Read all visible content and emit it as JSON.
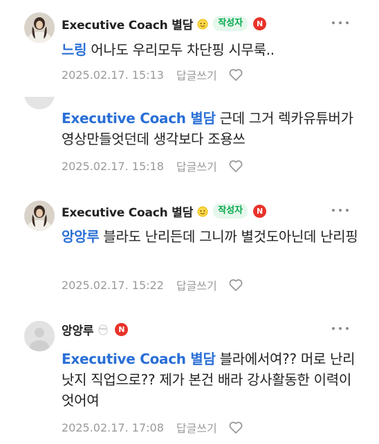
{
  "comments": [
    {
      "author": "Executive Coach 별담",
      "author_badge": "작성자",
      "n_badge": "N",
      "mention": "느링",
      "text": " 어나도 우리모두 차단핑 시무룩..",
      "date": "2025.02.17. 15:13",
      "reply_label": "답글쓰기"
    },
    {
      "mention": "Executive Coach 별담",
      "text": " 근데 그거 렉카유튜버가 영상만들엇던데 생각보다 조용쓰",
      "date": "2025.02.17. 15:18",
      "reply_label": "답글쓰기"
    },
    {
      "author": "Executive Coach 별담",
      "author_badge": "작성자",
      "n_badge": "N",
      "mention": "앙앙루",
      "text": " 블라도 난리든데 그니까 별것도아닌데 난리핑",
      "date": "2025.02.17. 15:22",
      "reply_label": "답글쓰기"
    },
    {
      "author": "앙앙루",
      "n_badge": "N",
      "mention": "Executive Coach 별담",
      "text": " 블라에서여?? 머로 난리낫지 직업으로?? 제가 본건 배라 강사활동한 이력이엇어여",
      "date": "2025.02.17. 17:08",
      "reply_label": "답글쓰기"
    }
  ],
  "icons": {
    "level_author": "smiley-level-icon",
    "level_commenter": "egg-level-icon",
    "more": "more-dots-icon",
    "like": "heart-outline-icon"
  },
  "colors": {
    "mention": "#2a6fd6",
    "author_badge_bg": "#e6f7ec",
    "author_badge_text": "#03a94d",
    "n_badge": "#e8332a",
    "meta": "#9a9a9a"
  }
}
